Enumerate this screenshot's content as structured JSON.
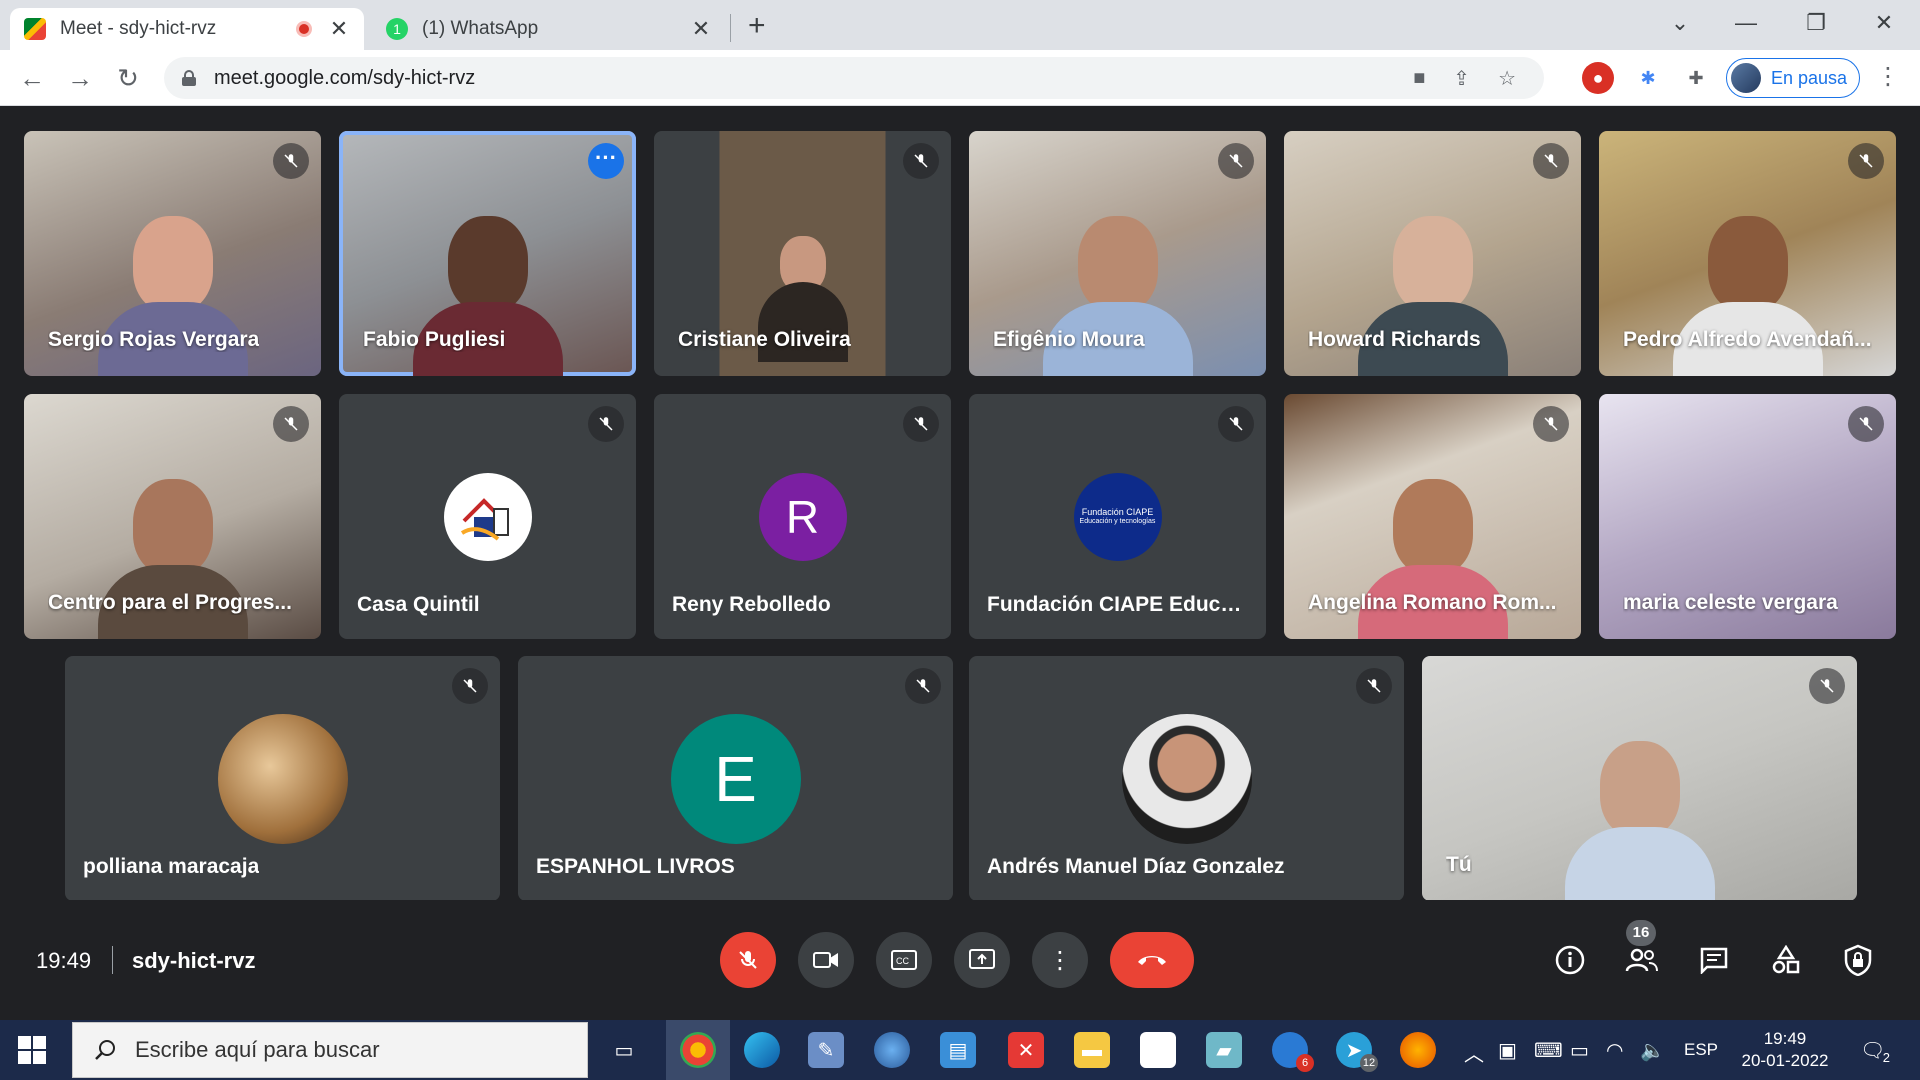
{
  "browser": {
    "tabs": [
      {
        "title": "Meet - sdy-hict-rvz",
        "active": true,
        "recording": true
      },
      {
        "title": "(1) WhatsApp",
        "active": false
      }
    ],
    "url": "meet.google.com/sdy-hict-rvz",
    "profile_label": "En pausa",
    "icons": {
      "back": "back-arrow-icon",
      "forward": "forward-arrow-icon",
      "reload": "reload-icon",
      "camera": "camera-icon",
      "share": "share-icon",
      "bookmark": "star-icon"
    }
  },
  "participants": [
    {
      "name": "Sergio Rojas Vergara",
      "type": "video",
      "muted": true
    },
    {
      "name": "Fabio Pugliesi",
      "type": "video",
      "speaking": true
    },
    {
      "name": "Cristiane Oliveira",
      "type": "video",
      "muted": true
    },
    {
      "name": "Efigênio Moura",
      "type": "video",
      "muted": true
    },
    {
      "name": "Howard Richards",
      "type": "video",
      "muted": true
    },
    {
      "name": "Pedro Alfredo Avendañ...",
      "type": "video",
      "muted": true
    },
    {
      "name": "Centro para el Progres...",
      "type": "video",
      "muted": true
    },
    {
      "name": "Casa Quintil",
      "type": "avatar-logo",
      "muted": true
    },
    {
      "name": "Reny Rebolledo",
      "type": "avatar-letter",
      "letter": "R",
      "color": "#7b1fa2",
      "muted": true
    },
    {
      "name": "Fundación CIAPE Educa...",
      "type": "avatar-logo",
      "logo_text": "Fundación CIAPE",
      "logo_sub": "Educación y tecnologías",
      "muted": true
    },
    {
      "name": "Angelina Romano Rom...",
      "type": "video",
      "muted": true
    },
    {
      "name": "maria celeste vergara",
      "type": "video",
      "muted": true
    },
    {
      "name": "polliana maracaja",
      "type": "avatar-photo",
      "muted": true
    },
    {
      "name": "ESPANHOL LIVROS",
      "type": "avatar-letter",
      "letter": "E",
      "color": "#00897b",
      "muted": true
    },
    {
      "name": "Andrés Manuel Díaz Gonzalez",
      "type": "avatar-photo",
      "muted": true
    },
    {
      "name": "Tú",
      "type": "video",
      "muted": true
    }
  ],
  "controls": {
    "time": "19:49",
    "meeting_code": "sdy-hict-rvz",
    "participant_count": "16"
  },
  "taskbar": {
    "search_placeholder": "Escribe aquí para buscar",
    "language": "ESP",
    "time": "19:49",
    "date": "20-01-2022",
    "notification_count": "2",
    "outlook_badge": "6",
    "telegram_badge": "12"
  },
  "colors": {
    "meet_bg": "#202124",
    "tile_bg": "#3c4043",
    "danger_red": "#ea4335",
    "accent_blue": "#1a73e8",
    "speaking_outline": "#8ab4f8"
  }
}
